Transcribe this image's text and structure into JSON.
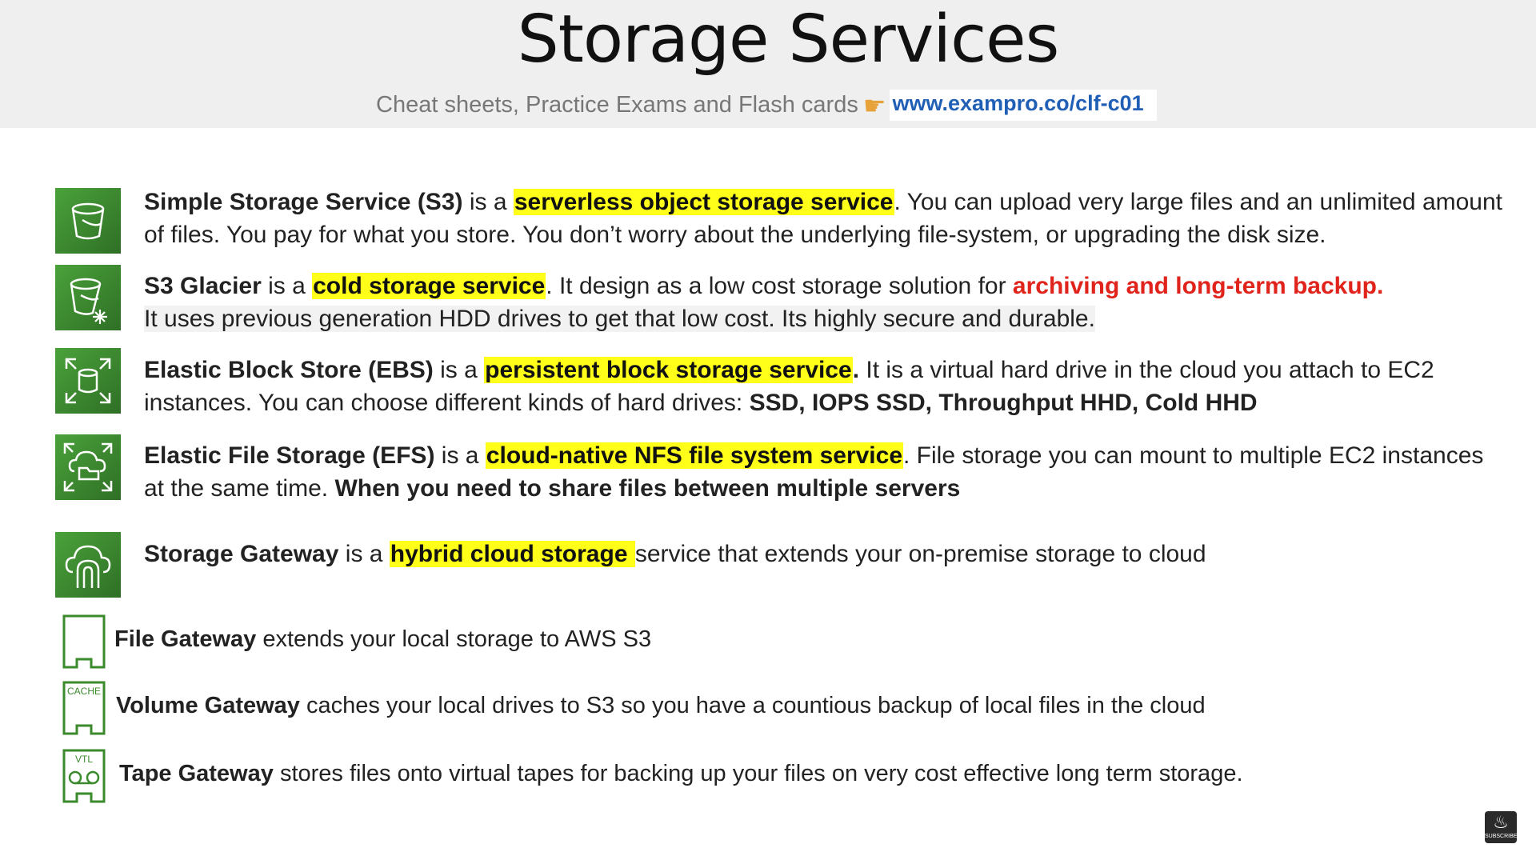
{
  "header": {
    "title": "Storage Services",
    "subtitle": "Cheat sheets, Practice Exams and Flash cards",
    "url": "www.exampro.co/clf-c01"
  },
  "services": [
    {
      "icon": "s3-bucket-icon",
      "name": "Simple Storage Service (S3)",
      "is_a": " is a ",
      "highlight": "serverless object storage service",
      "rest": ". You can upload very large files and an unlimited amount of files. You pay for what you store. You don’t worry about the underlying file-system, or upgrading the disk size."
    },
    {
      "icon": "glacier-bucket-icon",
      "name": "S3 Glacier",
      "is_a": " is a ",
      "highlight": "cold storage service",
      "rest_a": ". It design as a low cost storage solution for ",
      "red": "archiving and long-term backup.",
      "rest_b": "It uses previous generation HDD drives to get that low cost. Its highly secure and durable."
    },
    {
      "icon": "ebs-volume-icon",
      "name": "Elastic Block Store (EBS)",
      "is_a": " is a ",
      "highlight": "persistent block storage service",
      "dot": ".",
      "rest_a": " It is a virtual hard drive in the cloud you attach to EC2 instances. You can choose different kinds of hard drives: ",
      "bold_tail": "SSD, IOPS SSD, Throughput HHD, Cold HHD"
    },
    {
      "icon": "efs-cloud-folder-icon",
      "name": "Elastic File Storage (EFS)",
      "is_a": " is a ",
      "highlight": "cloud-native NFS file system service",
      "rest_a": ".  File storage you can mount to multiple EC2 instances at the same time.  ",
      "bold_tail": "When you need to share files between multiple servers"
    },
    {
      "icon": "storage-gateway-icon",
      "name": "Storage Gateway",
      "is_a": " is a ",
      "highlight": "hybrid cloud storage ",
      "rest_a": " service that extends your on-premise storage to cloud"
    }
  ],
  "gateways": [
    {
      "icon": "file-gateway-icon",
      "name": "File Gateway",
      "text": " extends your local storage to AWS S3"
    },
    {
      "icon": "volume-gateway-cache-icon",
      "label": "CACHE",
      "name": "Volume Gateway",
      "text": " caches your local drives to S3 so you have a countious backup of local files in the cloud"
    },
    {
      "icon": "tape-gateway-vtl-icon",
      "label": "VTL",
      "name": "Tape Gateway",
      "text": " stores files onto virtual tapes for backing up your files on very cost effective long term storage."
    }
  ],
  "badge": {
    "label": "SUBSCRIBE",
    "icon": "freecodecamp-logo-icon"
  },
  "colors": {
    "icon_green": "#3c8a2e",
    "highlight": "#ffff1a",
    "red": "#e0241b",
    "link": "#1f5fb5"
  }
}
